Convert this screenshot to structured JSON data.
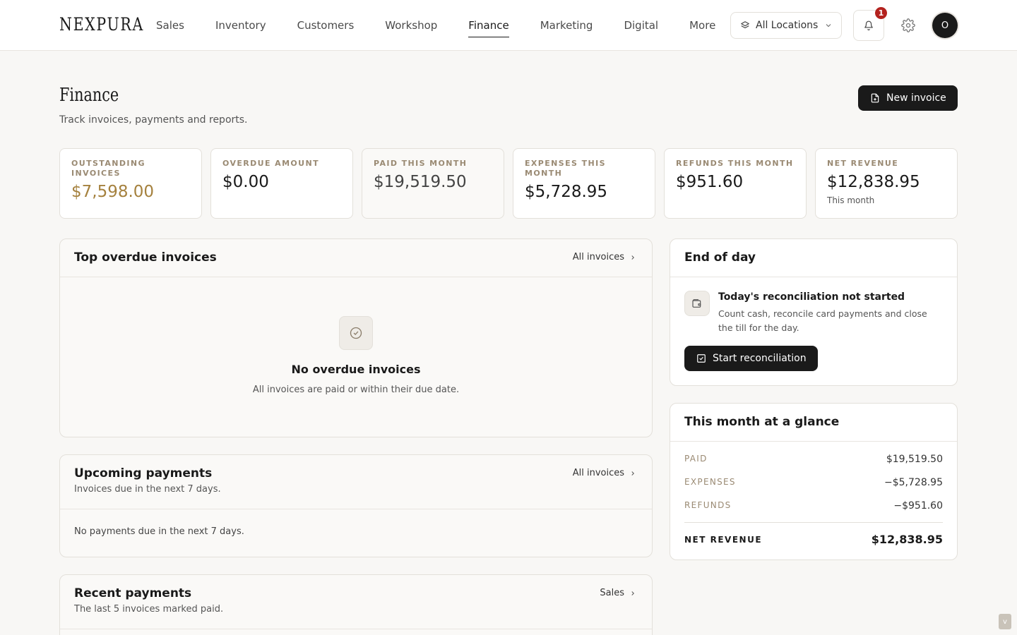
{
  "brand": "NEXPURA",
  "nav": {
    "items": [
      "Sales",
      "Inventory",
      "Customers",
      "Workshop",
      "Finance",
      "Marketing",
      "Digital",
      "More"
    ],
    "active": "Finance"
  },
  "header": {
    "location": "All Locations",
    "notifications": "1",
    "avatar_initial": "O"
  },
  "page": {
    "title": "Finance",
    "subtitle": "Track invoices, payments and reports.",
    "new_invoice": "New invoice"
  },
  "stats": [
    {
      "label": "OUTSTANDING INVOICES",
      "value": "$7,598.00",
      "note": ""
    },
    {
      "label": "OVERDUE AMOUNT",
      "value": "$0.00",
      "note": ""
    },
    {
      "label": "PAID THIS MONTH",
      "value": "$19,519.50",
      "note": ""
    },
    {
      "label": "EXPENSES THIS MONTH",
      "value": "$5,728.95",
      "note": ""
    },
    {
      "label": "REFUNDS THIS MONTH",
      "value": "$951.60",
      "note": ""
    },
    {
      "label": "NET REVENUE",
      "value": "$12,838.95",
      "note": "This month"
    }
  ],
  "overdue": {
    "title": "Top overdue invoices",
    "link": "All invoices",
    "empty_title": "No overdue invoices",
    "empty_desc": "All invoices are paid or within their due date."
  },
  "upcoming": {
    "title": "Upcoming payments",
    "subtitle": "Invoices due in the next 7 days.",
    "link": "All invoices",
    "empty": "No payments due in the next 7 days."
  },
  "recent": {
    "title": "Recent payments",
    "subtitle": "The last 5 invoices marked paid.",
    "link": "Sales"
  },
  "eod": {
    "title": "End of day",
    "status_title": "Today's reconciliation not started",
    "status_desc": "Count cash, reconcile card payments and close the till for the day.",
    "button": "Start reconciliation"
  },
  "glance": {
    "title": "This month at a glance",
    "rows": [
      {
        "label": "PAID",
        "value": "$19,519.50"
      },
      {
        "label": "EXPENSES",
        "value": "−$5,728.95"
      },
      {
        "label": "REFUNDS",
        "value": "−$951.60"
      }
    ],
    "total_label": "NET REVENUE",
    "total_value": "$12,838.95"
  },
  "corner_widget": "v"
}
